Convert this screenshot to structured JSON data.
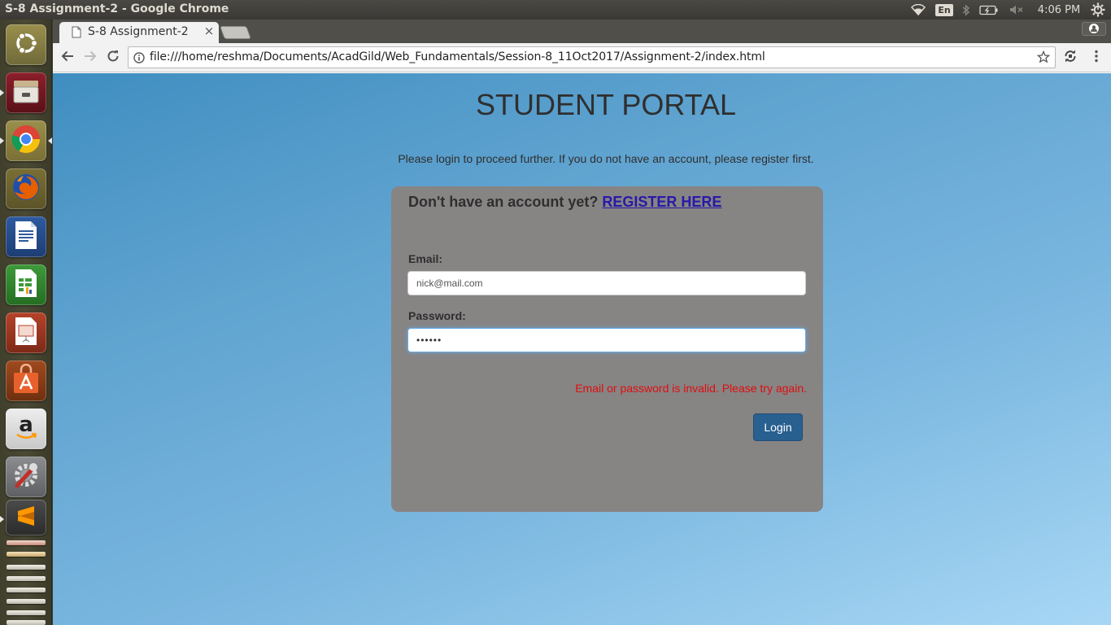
{
  "os": {
    "window_title": "S-8 Assignment-2 - Google Chrome",
    "tray": {
      "keyboard_layout": "En",
      "clock": "4:06 PM",
      "icons": [
        "wifi-icon",
        "bluetooth-icon",
        "battery-icon",
        "volume-muted-icon",
        "settings-gear-icon"
      ]
    },
    "launcher": {
      "items": [
        "ubuntu-dash",
        "files",
        "chrome",
        "firefox",
        "libreoffice-writer",
        "libreoffice-calc",
        "libreoffice-impress",
        "software-center",
        "amazon",
        "system-settings",
        "sublime-text",
        "workspace-stack"
      ]
    }
  },
  "browser": {
    "tab_title": "S-8 Assignment-2",
    "tab_close": "×",
    "url": "file:///home/reshma/Documents/AcadGild/Web_Fundamentals/Session-8_11Oct2017/Assignment-2/index.html"
  },
  "page": {
    "title": "STUDENT PORTAL",
    "intro": "Please login to proceed further. If you do not have an account, please register first.",
    "register_prompt": "Don't have an account yet?",
    "register_link": "REGISTER HERE",
    "email_label": "Email:",
    "email_value": "nick@mail.com",
    "password_label": "Password:",
    "password_value": "••••••",
    "error_message": "Email or password is invalid. Please try again.",
    "login_button": "Login"
  },
  "colors": {
    "page_bg_start": "#3f8ec0",
    "page_bg_end": "#a8d7f5",
    "card_bg": "#878484",
    "error": "#e00d0d",
    "button_primary": "#286090",
    "link": "#2719a8"
  }
}
